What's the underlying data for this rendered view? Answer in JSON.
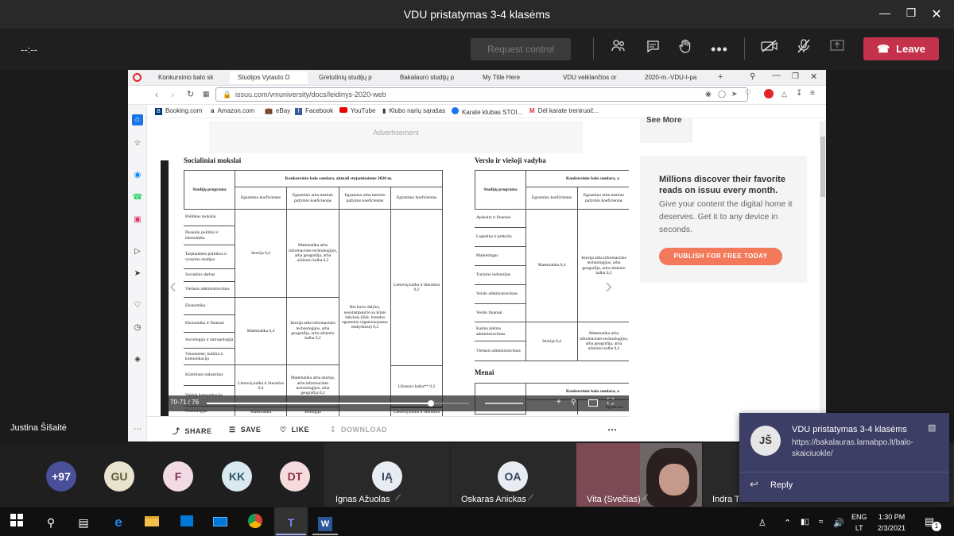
{
  "window": {
    "title": "VDU pristatymas 3-4 klasėms"
  },
  "call": {
    "timer": "--:--",
    "request_control": "Request control",
    "leave": "Leave",
    "presenter": "Justina Šišaitė"
  },
  "browser": {
    "tabs": [
      "Konkursinio balo sk",
      "Studijos Vytauto D",
      "Gretutinių studijų p",
      "Bakalauro studijų p",
      "My Title Here",
      "VDU veiklančios or",
      "2020-m.-VDU-I-pa"
    ],
    "url": "issuu.com/vmuniversity/docs/leidinys-2020-web",
    "bookmarks": [
      "Booking.com",
      "Amazon.com",
      "eBay",
      "Facebook",
      "YouTube",
      "Klubo narių sąrašas",
      "Karate klubas STOI...",
      "Dėl karate treniruoč..."
    ]
  },
  "issuu": {
    "advertisement": "Advertisement",
    "see_more": "See More",
    "promo_title": "Millions discover their favorite reads on issuu every month.",
    "promo_body": "Give your content the digital home it deserves. Get it to any device in seconds.",
    "publish_button": "PUBLISH FOR FREE TODAY",
    "page_indicator": "70-71 / 76",
    "share": "SHARE",
    "save": "SAVE",
    "like": "LIKE",
    "download": "DOWNLOAD"
  },
  "doc": {
    "left_heading": "Socialiniai mokslai",
    "right_heading": "Verslo ir viešoji vadyba",
    "bottom_heading": "Menai",
    "table_title": "Konkursinio balo sandara, aktuali stojantiesiems 2020 m.",
    "table_title_right": "Konkursinio balo sandara, a",
    "col_program": "Studijų programa",
    "col1": "Egzamino koeficientas",
    "col2": "Egzamino arba metinio pažymio koeficientas",
    "col3": "Egzamino arba metinio pažymio koeficientas",
    "col4": "Egzamino koeficientas",
    "left_programs": [
      "Politikos mokslai",
      "Pasaulio politika ir ekonomika",
      "Tarptautinės politikos ir vystymo studijos",
      "Socialinis darbas",
      "Viešasis administravimas",
      "Ekonomika",
      "Ekonomika ir finansai",
      "Sociologija ir antropologija",
      "Visuomenė, kultūra ir komunikacija",
      "Kūrybinės industrijos",
      "Viešoji komunikacija",
      "Psichologija"
    ],
    "left_c1a": "Istorija 0,4",
    "left_c2a": "Matematika arba informacinės technologijos, arba geografija, arba užsienio kalba 0,2",
    "left_c1b": "Matematika 0,4",
    "left_c2b": "Istorija arba informacinės technologijos, arba geografija, arba užsienio kalba 0,2",
    "left_c3": "Bet kurio dalyko, nesutampančio su kitais dalykais (išsk. brandos egzamino organizuojamas mokyklose) 0,2",
    "left_c4": "Lietuvių kalba ir literatūra 0,2",
    "left_c1c": "Lietuvių kalba ir literatūra 0,4",
    "left_c2c": "Matematika arba istorija, arba informacinės technologijos, arba geografija 0,2",
    "left_c4c": "Užsienio kalba** 0,2",
    "left_c1d": "Matematika",
    "left_c2d": "Biologija",
    "left_c4d": "Lietuvių kalba ir literatūra",
    "right_programs": [
      "Apskaita ir finansai",
      "Logistika ir prekyba",
      "Marketingas",
      "Turizmo industrijos",
      "Verslo administravimas",
      "Verslo finansai",
      "Kaimo plėtros administravimas",
      "Viešasis administravimas"
    ],
    "right_c1a": "Matematika 0,4",
    "right_c2a": "Istorija arba informacinės technologijos, arba geografija, arba užsienio kalba 0,2",
    "right_c1b": "Istorija 0,4",
    "right_c2b": "Matematika arba informacinės technologijos, arba geografija, arba užsienio kalba 0,2",
    "right_bottom_title": "Konkursinio balo sandara, a",
    "right_bottom_col": "Egzamino"
  },
  "participants": [
    {
      "initials": "+97",
      "color": "#4a4f9a"
    },
    {
      "initials": "GU",
      "color": "#e8e4cf"
    },
    {
      "initials": "F",
      "color": "#f3dbe6"
    },
    {
      "initials": "KK",
      "color": "#d9e9ef"
    },
    {
      "initials": "DT",
      "color": "#f5dade"
    }
  ],
  "tiles": [
    {
      "initials": "IĄ",
      "name": "Ignas Ažuolas"
    },
    {
      "initials": "OA",
      "name": "Oskaras Anickas"
    },
    {
      "name": "Vita (Svečias)"
    },
    {
      "name": "Indra T"
    }
  ],
  "notification": {
    "initials": "JŠ",
    "title": "VDU pristatymas 3-4 klasėms",
    "body": "https://bakalauras.lamabpo.lt/balo-skaiciuokle/",
    "reply": "Reply"
  },
  "taskbar": {
    "lang1": "ENG",
    "lang2": "LT",
    "time": "1:30 PM",
    "date": "2/3/2021",
    "notif_count": "1"
  }
}
